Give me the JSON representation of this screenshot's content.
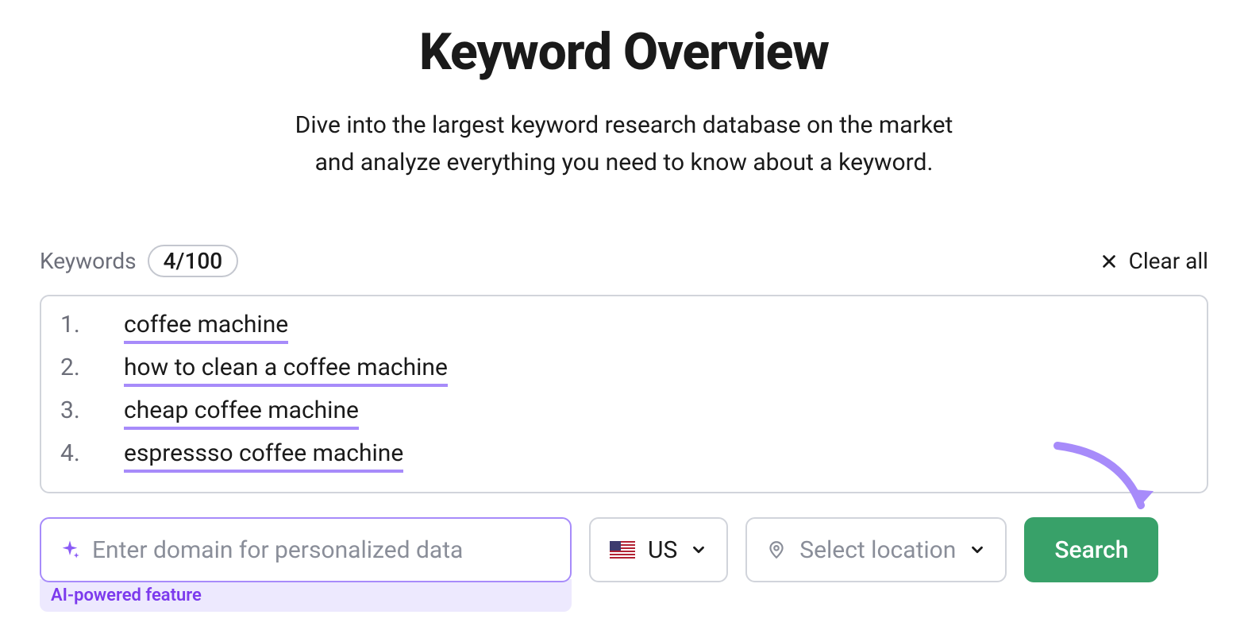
{
  "header": {
    "title": "Keyword Overview",
    "subtitle_line1": "Dive into the largest keyword research database on the market",
    "subtitle_line2": "and analyze everything you need to know about a keyword."
  },
  "keywords": {
    "label": "Keywords",
    "count": "4/100",
    "clear_label": "Clear all",
    "items": [
      {
        "num": "1.",
        "text": "coffee machine"
      },
      {
        "num": "2.",
        "text": "how to clean a coffee machine"
      },
      {
        "num": "3.",
        "text": "cheap coffee machine"
      },
      {
        "num": "4.",
        "text": "espressso coffee machine"
      }
    ]
  },
  "domain": {
    "placeholder": "Enter domain for personalized data",
    "ai_label": "AI-powered feature"
  },
  "country": {
    "code": "US"
  },
  "location": {
    "placeholder": "Select location"
  },
  "search": {
    "label": "Search"
  }
}
